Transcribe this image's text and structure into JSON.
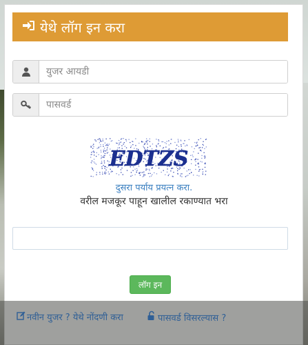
{
  "header": {
    "title": "येथे लॉग इन करा",
    "icon": "sign-in-icon",
    "color": "#de9b35"
  },
  "form": {
    "username": {
      "placeholder": "युजर आयडी",
      "value": "",
      "icon": "user-icon"
    },
    "password": {
      "placeholder": "पासवर्ड",
      "value": "",
      "icon": "key-icon"
    },
    "captcha": {
      "text": "EDTZS",
      "refresh_label": "दुसरा पर्याय प्रयत्न करा.",
      "instruction": "वरील मजकूर पाहून खालील रकाण्यात भरा",
      "value": ""
    },
    "login_button": "लॉग इन"
  },
  "footer": {
    "register_label": "नवीन युजर ? येथे नोंदणी करा",
    "register_icon": "edit-icon",
    "forgot_label": "पासवर्ड विसरल्यास ?",
    "forgot_icon": "unlock-icon"
  },
  "colors": {
    "accent": "#de9b35",
    "button": "#5cb85c",
    "link": "#3a7fc0"
  }
}
